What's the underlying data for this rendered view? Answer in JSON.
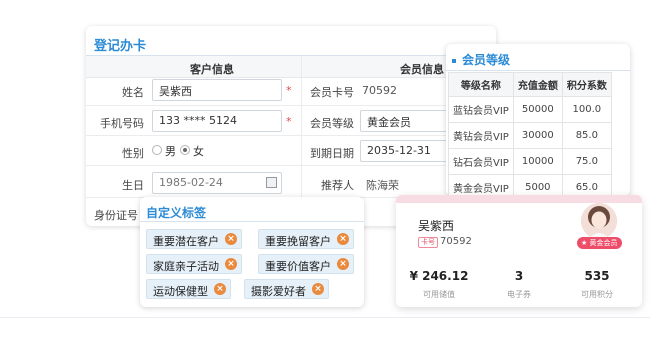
{
  "registration": {
    "title": "登记办卡",
    "section_customer": "客户信息",
    "section_member": "会员信息",
    "name_label": "姓名",
    "name_value": "吴紫西",
    "phone_label": "手机号码",
    "phone_value": "133 **** 5124",
    "gender_label": "性别",
    "gender_male": "男",
    "gender_female": "女",
    "birthday_label": "生日",
    "birthday_value": "1985-02-24",
    "idcard_label": "身份证号",
    "required_mark": "*",
    "card_no_label": "会员卡号",
    "card_no_value": "70592",
    "level_label": "会员等级",
    "level_value": "黄金会员",
    "expiry_label": "到期日期",
    "expiry_value": "2035-12-31",
    "referrer_label": "推荐人",
    "referrer_value": "陈海荣"
  },
  "member_levels": {
    "title": "会员等级",
    "headers": [
      "等级名称",
      "充值金额",
      "积分系数"
    ],
    "rows": [
      [
        "蓝钻会员VIP",
        "50000",
        "100.0"
      ],
      [
        "黄钻会员VIP",
        "30000",
        "85.0"
      ],
      [
        "钻石会员VIP",
        "10000",
        "75.0"
      ],
      [
        "黄金会员VIP",
        "5000",
        "65.0"
      ]
    ]
  },
  "tags": {
    "title": "自定义标签",
    "items": [
      "重要潜在客户",
      "重要挽留客户",
      "家庭亲子活动",
      "重要价值客户",
      "运动保健型",
      "摄影爱好者"
    ],
    "remove_glyph": "×"
  },
  "card": {
    "name": "吴紫西",
    "badge": "卡号",
    "number": "70592",
    "vip_badge": "★ 黄金会员",
    "balance_value": "¥ 246.12",
    "balance_label": "可用储值",
    "coupon_value": "3",
    "coupon_label": "电子券",
    "points_value": "535",
    "points_label": "可用积分"
  },
  "colors": {
    "accent": "#2b8bd6",
    "tag_bg": "#e6f0f8",
    "tag_remove": "#e98a3d",
    "vip_pink": "#ee4d6a"
  }
}
